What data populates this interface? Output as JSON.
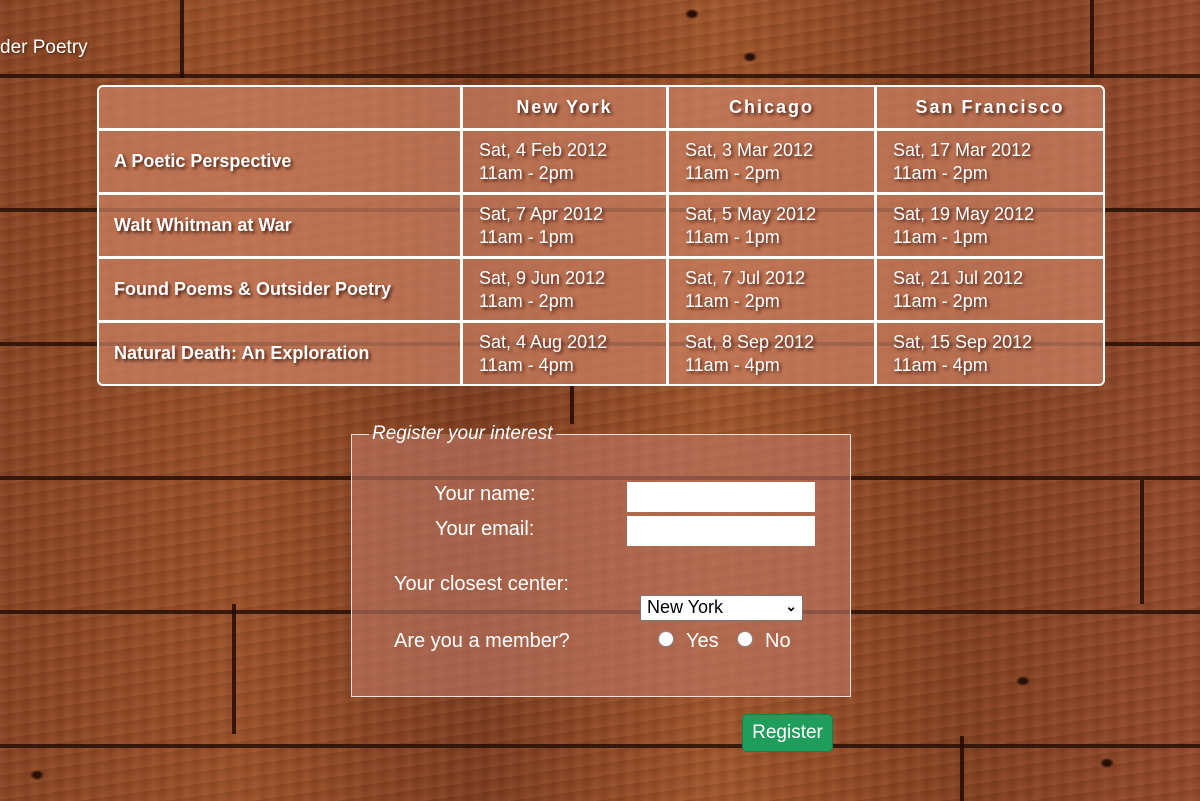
{
  "page": {
    "title": "der Poetry"
  },
  "schedule": {
    "headers": [
      "",
      "New York",
      "Chicago",
      "San Francisco"
    ],
    "rows": [
      {
        "event": "A Poetic Perspective",
        "slots": [
          [
            "Sat, 4 Feb 2012",
            "11am - 2pm"
          ],
          [
            "Sat, 3 Mar 2012",
            "11am - 2pm"
          ],
          [
            "Sat, 17 Mar 2012",
            "11am - 2pm"
          ]
        ]
      },
      {
        "event": "Walt Whitman at War",
        "slots": [
          [
            "Sat, 7 Apr 2012",
            "11am - 1pm"
          ],
          [
            "Sat, 5 May 2012",
            "11am - 1pm"
          ],
          [
            "Sat, 19 May 2012",
            "11am - 1pm"
          ]
        ]
      },
      {
        "event": "Found Poems & Outsider Poetry",
        "slots": [
          [
            "Sat, 9 Jun 2012",
            "11am - 2pm"
          ],
          [
            "Sat, 7 Jul 2012",
            "11am - 2pm"
          ],
          [
            "Sat, 21 Jul 2012",
            "11am - 2pm"
          ]
        ]
      },
      {
        "event": "Natural Death: An Exploration",
        "slots": [
          [
            "Sat, 4 Aug 2012",
            "11am - 4pm"
          ],
          [
            "Sat, 8 Sep 2012",
            "11am - 4pm"
          ],
          [
            "Sat, 15 Sep 2012",
            "11am - 4pm"
          ]
        ]
      }
    ]
  },
  "form": {
    "legend": "Register your interest",
    "name_label": "Your name:",
    "name_value": "",
    "email_label": "Your email:",
    "email_value": "",
    "center_label": "Your closest center:",
    "center_selected": "New York",
    "member_label": "Are you a member?",
    "member_options": [
      "Yes",
      "No"
    ],
    "register_label": "Register"
  },
  "colors": {
    "accent": "#1e9e5a",
    "panel": "#c98064",
    "text": "#ffffff"
  },
  "icons": {
    "select_arrow": "chevron-down-icon"
  }
}
